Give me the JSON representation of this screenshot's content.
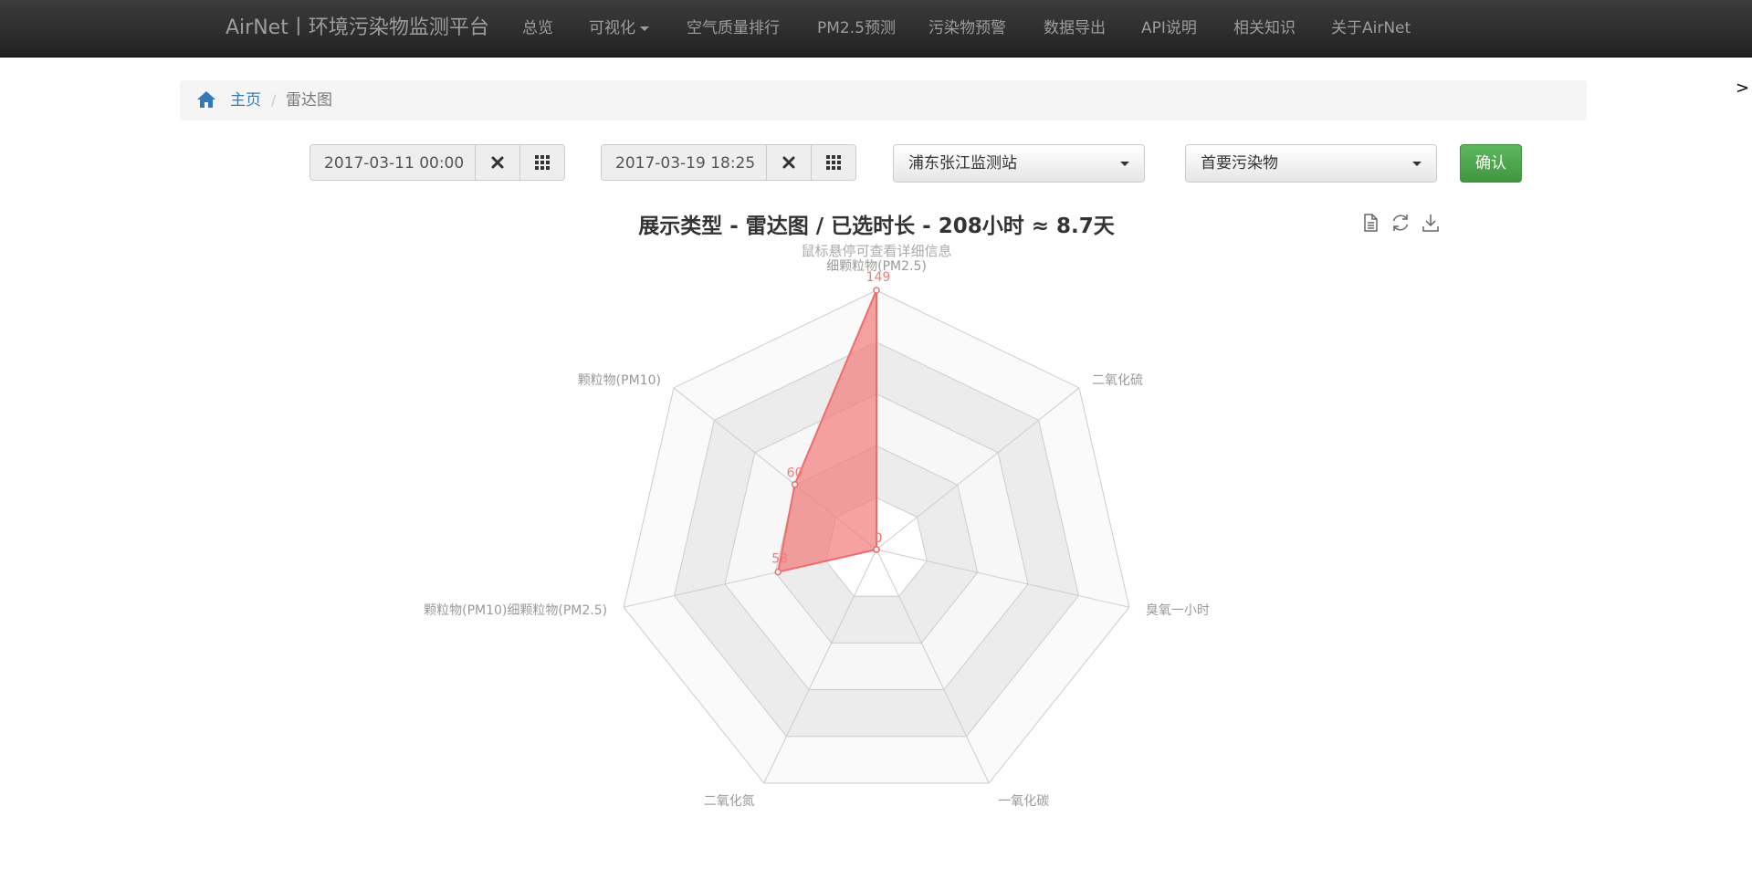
{
  "nav": {
    "brand": "AirNet丨环境污染物监测平台",
    "items": [
      "总览",
      "可视化",
      "空气质量排行",
      "PM2.5预测",
      "污染物预警",
      "数据导出",
      "API说明",
      "相关知识",
      "关于AirNet"
    ]
  },
  "edge_arrow": ">",
  "breadcrumb": {
    "home": "主页",
    "separator": "/",
    "current": "雷达图"
  },
  "filters": {
    "start_date": "2017-03-11 00:00",
    "end_date": "2017-03-19 18:25",
    "station": "浦东张江监测站",
    "pollutant": "首要污染物",
    "confirm": "确认"
  },
  "toolbox": [
    "data-view-icon",
    "refresh-icon",
    "download-icon"
  ],
  "chart_data": {
    "type": "radar",
    "title": "展示类型 - 雷达图 / 已选时长 - 208小时 ≈ 8.7天",
    "subtitle": "鼠标悬停可查看详细信息",
    "indicators": [
      "细颗粒物(PM2.5)",
      "二氧化硫",
      "臭氧一小时",
      "一氧化碳",
      "二氧化氮",
      "颗粒物(PM10)细颗粒物(PM2.5)",
      "颗粒物(PM10)"
    ],
    "max": 149,
    "series": [
      {
        "values": [
          149,
          0,
          0,
          0,
          0,
          58,
          60
        ],
        "labels": [
          "149",
          "0",
          "0",
          "0",
          "0",
          "58",
          "60"
        ]
      }
    ],
    "series_color": "#f47a7a"
  }
}
